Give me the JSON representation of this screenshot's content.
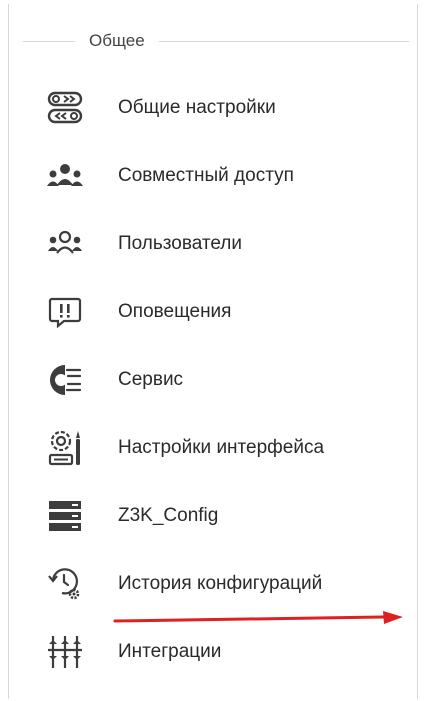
{
  "section": {
    "title": "Общее"
  },
  "menu": {
    "items": [
      {
        "label": "Общие настройки",
        "icon": "toggle-settings-icon"
      },
      {
        "label": "Совместный доступ",
        "icon": "shared-access-icon"
      },
      {
        "label": "Пользователи",
        "icon": "users-icon"
      },
      {
        "label": "Оповещения",
        "icon": "notifications-icon"
      },
      {
        "label": "Сервис",
        "icon": "service-icon"
      },
      {
        "label": "Настройки интерфейса",
        "icon": "interface-settings-icon"
      },
      {
        "label": "Z3K_Config",
        "icon": "server-icon"
      },
      {
        "label": "История конфигураций",
        "icon": "config-history-icon"
      },
      {
        "label": "Интеграции",
        "icon": "integrations-icon"
      }
    ]
  },
  "annotation": {
    "color": "#e02020",
    "target": "История конфигураций"
  }
}
